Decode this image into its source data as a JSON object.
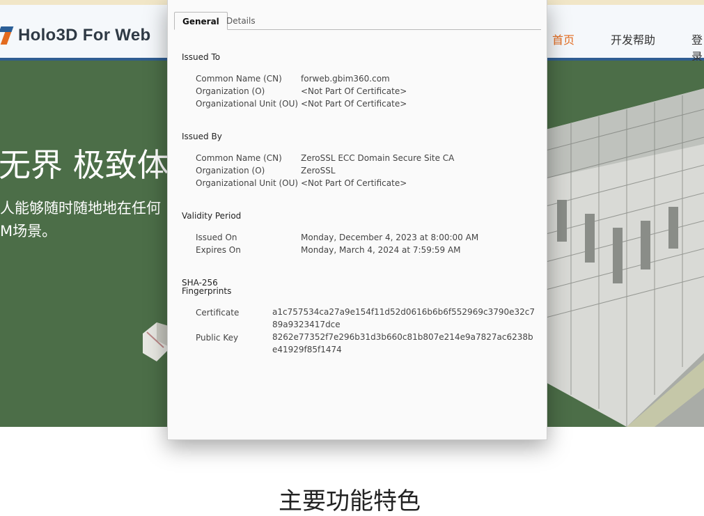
{
  "site": {
    "logo_text": "Holo3D For Web",
    "nav": [
      "首页",
      "开发帮助",
      "登录"
    ],
    "hero_title": "无界 极致体验",
    "hero_line1": "人能够随时随地地在任何",
    "hero_line2": "M场景。",
    "section_title": "主要功能特色"
  },
  "dialog": {
    "tabs": [
      {
        "label": "General",
        "active": true
      },
      {
        "label": "Details",
        "active": false
      }
    ],
    "issued_to": {
      "heading": "Issued To",
      "rows": [
        {
          "label": "Common Name (CN)",
          "value": "forweb.gbim360.com"
        },
        {
          "label": "Organization (O)",
          "value": "<Not Part Of Certificate>"
        },
        {
          "label": "Organizational Unit (OU)",
          "value": "<Not Part Of Certificate>"
        }
      ]
    },
    "issued_by": {
      "heading": "Issued By",
      "rows": [
        {
          "label": "Common Name (CN)",
          "value": "ZeroSSL ECC Domain Secure Site CA"
        },
        {
          "label": "Organization (O)",
          "value": "ZeroSSL"
        },
        {
          "label": "Organizational Unit (OU)",
          "value": "<Not Part Of Certificate>"
        }
      ]
    },
    "validity": {
      "heading": "Validity Period",
      "rows": [
        {
          "label": "Issued On",
          "value": "Monday, December 4, 2023 at 8:00:00 AM"
        },
        {
          "label": "Expires On",
          "value": "Monday, March 4, 2024 at 7:59:59 AM"
        }
      ]
    },
    "fingerprints": {
      "heading_line1": "SHA-256",
      "heading_line2": "Fingerprints",
      "rows": [
        {
          "label": "Certificate",
          "value": "a1c757534ca27a9e154f11d52d0616b6b6f552969c3790e32c789a9323417dce"
        },
        {
          "label": "Public Key",
          "value": "8262e77352f7e296b31d3b660c81b807e214e9a7827ac6238be41929f85f1474"
        }
      ]
    }
  },
  "colors": {
    "header_border": "#2f5d91",
    "accent": "#e36b1f",
    "hero_bg": "#4c6e48"
  }
}
